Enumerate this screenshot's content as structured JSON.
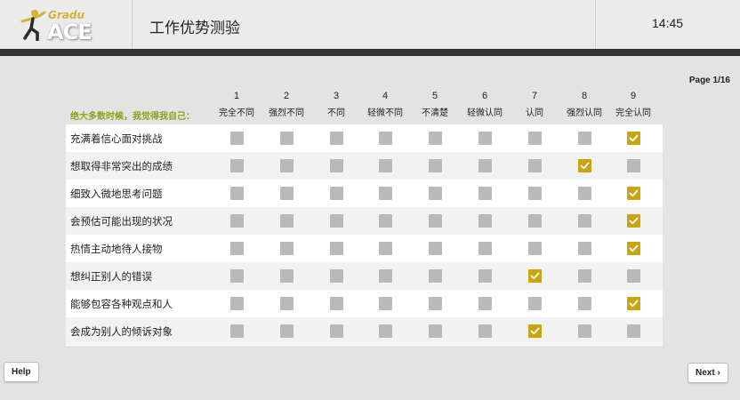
{
  "header": {
    "logo_top": "Gradu",
    "logo_main": "ACE",
    "title": "工作优势测验",
    "time": "14:45"
  },
  "page_indicator": "Page 1/16",
  "prompt": "绝大多数时候，我觉得我自己：",
  "scale": [
    {
      "num": "1",
      "label": "完全不同"
    },
    {
      "num": "2",
      "label": "强烈不同"
    },
    {
      "num": "3",
      "label": "不同"
    },
    {
      "num": "4",
      "label": "轻微不同"
    },
    {
      "num": "5",
      "label": "不清楚"
    },
    {
      "num": "6",
      "label": "轻微认同"
    },
    {
      "num": "7",
      "label": "认同"
    },
    {
      "num": "8",
      "label": "强烈认同"
    },
    {
      "num": "9",
      "label": "完全认同"
    }
  ],
  "items": [
    {
      "statement": "充满着信心面对挑战",
      "selected": 9
    },
    {
      "statement": "想取得非常突出的成绩",
      "selected": 8
    },
    {
      "statement": "细致入微地思考问题",
      "selected": 9
    },
    {
      "statement": "会预估可能出现的状况",
      "selected": 9
    },
    {
      "statement": "热情主动地待人接物",
      "selected": 9
    },
    {
      "statement": "想纠正别人的错误",
      "selected": 7
    },
    {
      "statement": "能够包容各种观点和人",
      "selected": 9
    },
    {
      "statement": "会成为别人的倾诉对象",
      "selected": 7
    }
  ],
  "buttons": {
    "help": "Help",
    "next": "Next ›"
  },
  "colors": {
    "checked": "#c9a40d",
    "unchecked": "#b9b9b9",
    "prompt": "#8ba41a",
    "header_bar": "#333333"
  }
}
